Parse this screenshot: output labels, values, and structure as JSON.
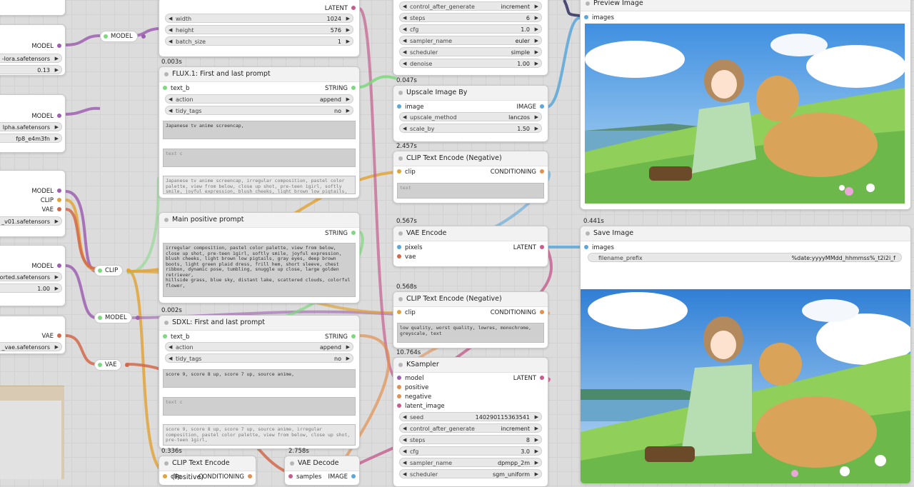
{
  "left": {
    "model1": "MODEL",
    "lora1": "-lora.safetensors",
    "str1": "0.13",
    "model2": "MODEL",
    "file2a": "lpha.safetensors",
    "file2b": "fp8_e4m3fn",
    "model3": "MODEL",
    "clip3": "CLIP",
    "vae3": "VAE",
    "file3": "_v01.safetensors",
    "model4": "MODEL",
    "file4": "orted.safetensors",
    "str4": "1.00",
    "vae5": "VAE",
    "file5": "_vae.safetensors"
  },
  "reroutes": {
    "model_a": "MODEL",
    "clip": "CLIP",
    "model_b": "MODEL",
    "vae": "VAE"
  },
  "latent_node": {
    "out": "LATENT",
    "width_label": "width",
    "width": "1024",
    "height_label": "height",
    "height": "576",
    "batch_label": "batch_size",
    "batch": "1"
  },
  "flux": {
    "time": "0.003s",
    "title": "FLUX.1: First and last prompt",
    "in": "text_b",
    "out": "STRING",
    "action_label": "action",
    "action": "append",
    "tidy_label": "tidy_tags",
    "tidy": "no",
    "text_a": "Japanese tv anime screencap,",
    "text_c": "text c",
    "preview": "Japanese tv anime screencap, irregular composition, pastel color palette, view from below, close up shot, pre-teen 1girl, softly smile, joyful expression, blush cheeks, light brown low pigtails, gray eyes, deep brown boots, light green plaid dress, frill hem,"
  },
  "main": {
    "title": "Main positive prompt",
    "out": "STRING",
    "text": "irregular composition, pastel color palette, view from below, close up shot, pre-teen 1girl, softly smile, joyful expression, blush cheeks, light brown low pigtails, gray eyes, deep brown boots, light green plaid dress, frill hem, short sleeve, chest ribbon, dynamic pose, tumbling, snuggle up close, large golden retriever,\nhillside grass, blue sky, distant lake, scattered clouds, colorful flower,"
  },
  "sdxl": {
    "time": "0.002s",
    "title": "SDXL: First and last prompt",
    "in": "text_b",
    "out": "STRING",
    "action_label": "action",
    "action": "append",
    "tidy_label": "tidy_tags",
    "tidy": "no",
    "text_a": "score 9, score 8 up, score 7 up, source anime,",
    "text_c": "text c",
    "preview": "score 9, score 8 up, score 7 up, source anime, irregular composition, pastel color palette, view from below, close up shot, pre-teen 1girl,"
  },
  "clip_pos": {
    "time": "0.336s",
    "title": "CLIP Text Encode (Positive)",
    "in": "clip",
    "out": "CONDITIONING"
  },
  "vae_decode": {
    "time": "2.758s",
    "title": "VAE Decode",
    "in": "samples",
    "out": "IMAGE"
  },
  "ks_top": {
    "cag_label": "control_after_generate",
    "cag": "increment",
    "steps_label": "steps",
    "steps": "6",
    "cfg_label": "cfg",
    "cfg": "1.0",
    "sampler_label": "sampler_name",
    "sampler": "euler",
    "sched_label": "scheduler",
    "sched": "simple",
    "denoise_label": "denoise",
    "denoise": "1.00"
  },
  "upscale": {
    "time": "0.047s",
    "title": "Upscale Image By",
    "in": "image",
    "out": "IMAGE",
    "method_label": "upscale_method",
    "method": "lanczos",
    "scale_label": "scale_by",
    "scale": "1.50"
  },
  "clip_neg1": {
    "time": "2.457s",
    "title": "CLIP Text Encode (Negative)",
    "in": "clip",
    "out": "CONDITIONING",
    "text": "text"
  },
  "vae_encode": {
    "time": "0.567s",
    "title": "VAE Encode",
    "in1": "pixels",
    "in2": "vae",
    "out": "LATENT"
  },
  "clip_neg2": {
    "time": "0.568s",
    "title": "CLIP Text Encode (Negative)",
    "in": "clip",
    "out": "CONDITIONING",
    "text": "low quality, worst quality, lowres, monochrome, greyscale, text"
  },
  "ksampler": {
    "time": "10.764s",
    "title": "KSampler",
    "in1": "model",
    "in2": "positive",
    "in3": "negative",
    "in4": "latent_image",
    "out": "LATENT",
    "seed_label": "seed",
    "seed": "140290115363541",
    "cag_label": "control_after_generate",
    "cag": "increment",
    "steps_label": "steps",
    "steps": "8",
    "cfg_label": "cfg",
    "cfg": "3.0",
    "sampler_label": "sampler_name",
    "sampler": "dpmpp_2m",
    "sched_label": "scheduler",
    "sched": "sgm_uniform"
  },
  "preview": {
    "title": "Preview Image",
    "in": "images"
  },
  "save": {
    "time": "0.441s",
    "title": "Save Image",
    "in": "images",
    "fp_label": "filename_prefix",
    "fp": "%date:yyyyMMdd_hhmmss%_t2i2i_f"
  },
  "colors": {
    "model": "#9d5fb0",
    "clip": "#e0a43a",
    "vae": "#d2684a",
    "latent": "#c45e8f",
    "string": "#7ed87e",
    "image": "#5aa7d8",
    "conditioning": "#e09050"
  }
}
